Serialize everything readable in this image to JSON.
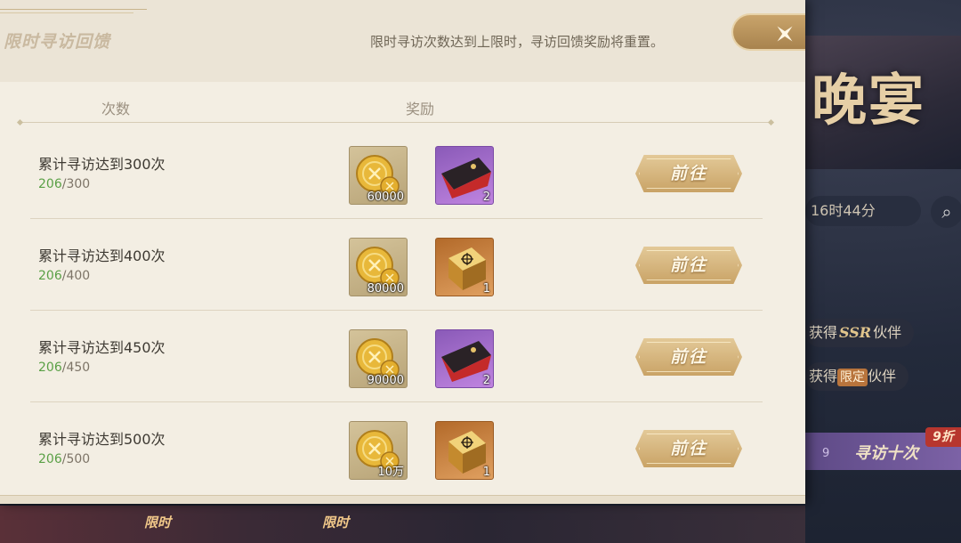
{
  "background": {
    "banner_title": "晚宴",
    "timer": "16时44分",
    "chip_ssr": {
      "prefix": "获得",
      "emph": "SSR",
      "suffix": "伙伴"
    },
    "chip_limited": {
      "prefix": "获得",
      "tag": "限定",
      "suffix": "伙伴"
    },
    "ten_pull_label": "寻访十次",
    "ten_pull_count": "9",
    "discount_badge": "9折",
    "bottom_label_1": "限时",
    "bottom_label_2": "限时"
  },
  "panel": {
    "title": "限时寻访回馈",
    "notice": "限时寻访次数达到上限时，寻访回馈奖励将重置。",
    "col_count": "次数",
    "col_reward": "奖励"
  },
  "rows": [
    {
      "title": "累计寻访达到300次",
      "current": "206",
      "total": "/300",
      "coin_qty": "60000",
      "item_qty": "2",
      "item_kind": "purple",
      "button": "前往"
    },
    {
      "title": "累计寻访达到400次",
      "current": "206",
      "total": "/400",
      "coin_qty": "80000",
      "item_qty": "1",
      "item_kind": "orange",
      "button": "前往"
    },
    {
      "title": "累计寻访达到450次",
      "current": "206",
      "total": "/450",
      "coin_qty": "90000",
      "item_qty": "2",
      "item_kind": "purple",
      "button": "前往"
    },
    {
      "title": "累计寻访达到500次",
      "current": "206",
      "total": "/500",
      "coin_qty": "10万",
      "item_qty": "1",
      "item_kind": "orange",
      "button": "前往"
    }
  ],
  "icons": {
    "close": "close-icon",
    "search": "search-icon",
    "coin": "gold-coin-icon",
    "envelope": "red-envelope-icon",
    "box": "treasure-box-icon"
  },
  "colors": {
    "accent_gold": "#c9a366",
    "progress_green": "#5aa046",
    "panel_bg": "#f1ece0"
  }
}
